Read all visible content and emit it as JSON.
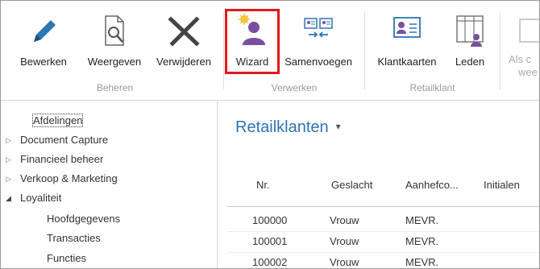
{
  "ribbon": {
    "buttons": [
      {
        "label": "Bewerken",
        "icon": "pencil-icon"
      },
      {
        "label": "Weergeven",
        "icon": "view-document-icon"
      },
      {
        "label": "Verwijderen",
        "icon": "delete-x-icon"
      },
      {
        "label": "Wizard",
        "icon": "wizard-user-icon"
      },
      {
        "label": "Samenvoegen",
        "icon": "merge-cards-icon"
      },
      {
        "label": "Klantkaarten",
        "icon": "customer-card-icon"
      },
      {
        "label": "Leden",
        "icon": "members-table-icon"
      },
      {
        "label": "Als c",
        "label2": "wee",
        "icon": "partial-icon"
      }
    ],
    "groups": [
      "Beheren",
      "Verwerken",
      "Retailklant"
    ],
    "highlight_color": "#e11a1a"
  },
  "sidebar": {
    "items": [
      {
        "label": "Afdelingen",
        "arrow": ""
      },
      {
        "label": "Document Capture",
        "arrow": "▷"
      },
      {
        "label": "Financieel beheer",
        "arrow": "▷"
      },
      {
        "label": "Verkoop & Marketing",
        "arrow": "▷"
      },
      {
        "label": "Loyaliteit",
        "arrow": "◢"
      },
      {
        "label": "Hoofdgegevens",
        "arrow": ""
      },
      {
        "label": "Transacties",
        "arrow": ""
      },
      {
        "label": "Functies",
        "arrow": ""
      }
    ]
  },
  "main": {
    "title": "Retailklanten",
    "title_caret": "▾",
    "columns": [
      "Nr.",
      "Geslacht",
      "Aanhefco...",
      "Initialen"
    ],
    "rows": [
      [
        "100000",
        "Vrouw",
        "MEVR."
      ],
      [
        "100001",
        "Vrouw",
        "MEVR."
      ],
      [
        "100002",
        "Vrouw",
        "MEVR."
      ]
    ],
    "accent_color": "#2e75b6"
  }
}
